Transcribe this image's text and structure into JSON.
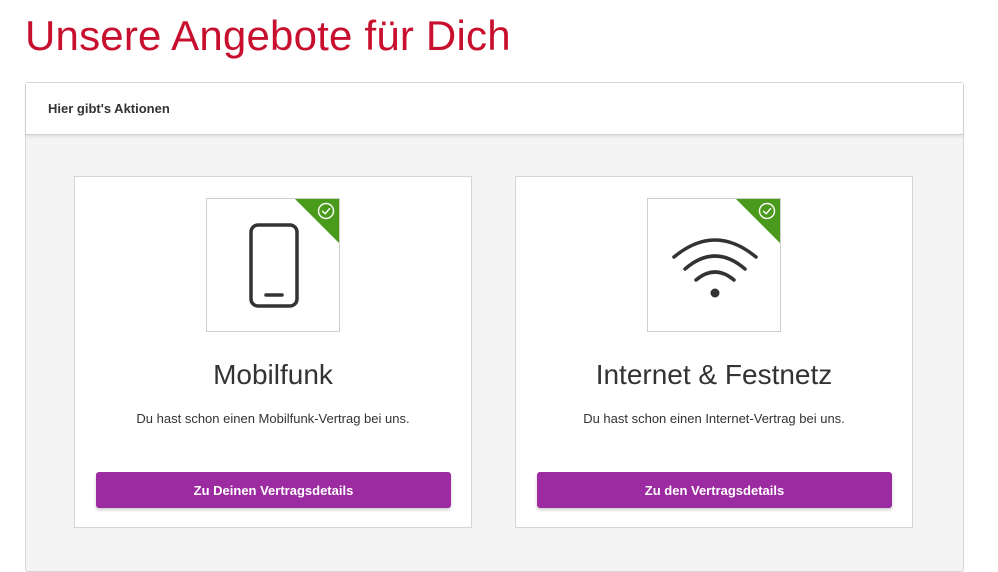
{
  "page": {
    "title": "Unsere Angebote für Dich"
  },
  "panel": {
    "header": "Hier gibt's Aktionen"
  },
  "cards": [
    {
      "icon": "mobile-phone-icon",
      "badge_icon": "check-circle-icon",
      "title": "Mobilfunk",
      "description": "Du hast schon einen Mobilfunk-Vertrag bei uns.",
      "button_label": "Zu Deinen Vertragsdetails"
    },
    {
      "icon": "wifi-icon",
      "badge_icon": "check-circle-icon",
      "title": "Internet & Festnetz",
      "description": "Du hast schon einen Internet-Vertrag bei uns.",
      "button_label": "Zu den Vertragsdetails"
    }
  ],
  "colors": {
    "title_red": "#c8102e",
    "button_purple": "#9c2aa0",
    "badge_green": "#4a9a1c"
  }
}
